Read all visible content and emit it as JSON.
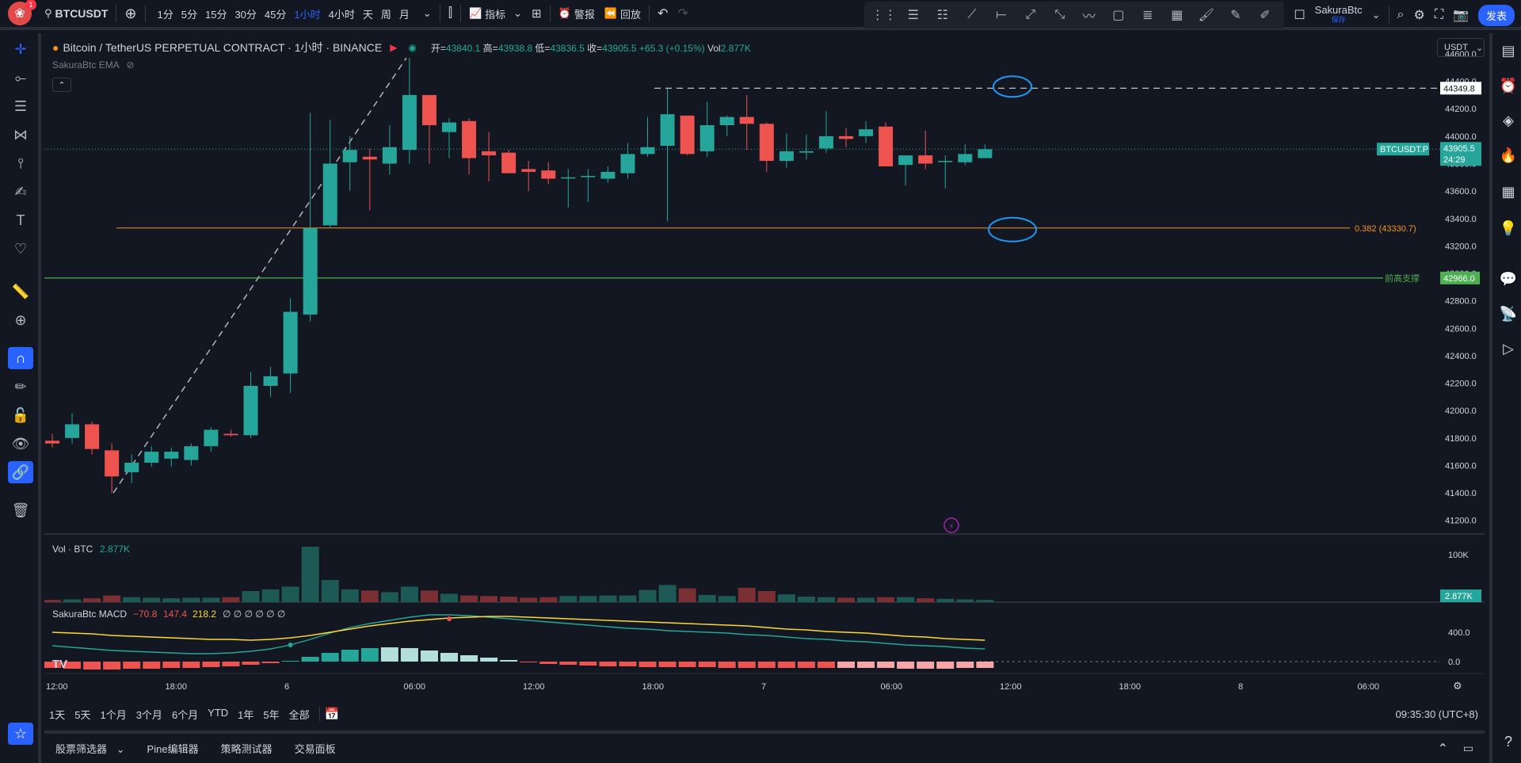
{
  "topbar": {
    "badge": "1",
    "symbol": "BTCUSDT",
    "timeframes": [
      "1分",
      "5分",
      "15分",
      "30分",
      "45分",
      "1小时",
      "4小时",
      "天",
      "周",
      "月"
    ],
    "active_timeframe": "1小时",
    "indicators_label": "指标",
    "alert_label": "警报",
    "replay_label": "回放",
    "user_name": "SakuraBtc",
    "user_sub": "保存",
    "publish_label": "发表"
  },
  "legend": {
    "title": "Bitcoin / TetherUS PERPETUAL CONTRACT · 1小时 · BINANCE",
    "open_k": "开=",
    "open_v": "43840.1",
    "high_k": "高=",
    "high_v": "43938.8",
    "low_k": "低=",
    "low_v": "43836.5",
    "close_k": "收=",
    "close_v": "43905.5",
    "change": "+65.3 (+0.15%)",
    "vol_k": "Vol",
    "vol_v": "2.877K",
    "ema": "SakuraBtc EMA",
    "unit": "USDT"
  },
  "price_axis": {
    "ticks": [
      "44600.0",
      "44400.0",
      "44200.0",
      "44000.0",
      "43800.0",
      "43600.0",
      "43400.0",
      "43200.0",
      "43000.0",
      "42800.0",
      "42600.0",
      "42400.0",
      "42200.0",
      "42000.0",
      "41800.0",
      "41600.0",
      "41400.0",
      "41200.0"
    ],
    "dashed_label": "44349.8",
    "current_name": "BTCUSDT.P",
    "current_price": "43905.5",
    "countdown": "24:29",
    "fib_label": "0.382 (43330.7)",
    "support_name": "前高支撑",
    "support_price": "42966.0"
  },
  "volume_pane": {
    "label": "Vol · BTC",
    "value": "2.877K",
    "axis": "100K",
    "badge": "2.877K"
  },
  "macd_pane": {
    "label": "SakuraBtc MACD",
    "v1": "−70.8",
    "v2": "147.4",
    "v3": "218.2",
    "rest": "∅ ∅ ∅ ∅ ∅ ∅",
    "axis_top": "400.0",
    "axis_zero": "0.0"
  },
  "time_axis": [
    "12:00",
    "18:00",
    "6",
    "06:00",
    "12:00",
    "18:00",
    "7",
    "06:00",
    "12:00",
    "18:00",
    "8",
    "06:00"
  ],
  "rangebar": {
    "ranges": [
      "1天",
      "5天",
      "1个月",
      "3个月",
      "6个月",
      "YTD",
      "1年",
      "5年",
      "全部"
    ],
    "clock": "09:35:30 (UTC+8)"
  },
  "bottombar": {
    "tabs": [
      "股票筛选器",
      "Pine编辑器",
      "策略测试器",
      "交易面板"
    ]
  },
  "chart_data": {
    "type": "candlestick",
    "title": "Bitcoin / TetherUS PERPETUAL CONTRACT · 1小时 · BINANCE",
    "ylim": [
      41100,
      44750
    ],
    "x_index_start": 0,
    "candles": [
      {
        "o": 41780,
        "h": 41830,
        "l": 41730,
        "c": 41760
      },
      {
        "o": 41800,
        "h": 41980,
        "l": 41760,
        "c": 41900
      },
      {
        "o": 41900,
        "h": 41920,
        "l": 41680,
        "c": 41720
      },
      {
        "o": 41710,
        "h": 41760,
        "l": 41400,
        "c": 41520
      },
      {
        "o": 41550,
        "h": 41680,
        "l": 41470,
        "c": 41620
      },
      {
        "o": 41620,
        "h": 41740,
        "l": 41590,
        "c": 41700
      },
      {
        "o": 41650,
        "h": 41730,
        "l": 41590,
        "c": 41700
      },
      {
        "o": 41640,
        "h": 41760,
        "l": 41600,
        "c": 41740
      },
      {
        "o": 41740,
        "h": 41880,
        "l": 41700,
        "c": 41860
      },
      {
        "o": 41830,
        "h": 41860,
        "l": 41810,
        "c": 41820
      },
      {
        "o": 41820,
        "h": 42280,
        "l": 41800,
        "c": 42180
      },
      {
        "o": 42180,
        "h": 42320,
        "l": 42100,
        "c": 42250
      },
      {
        "o": 42270,
        "h": 42820,
        "l": 42130,
        "c": 42720
      },
      {
        "o": 42700,
        "h": 44170,
        "l": 42650,
        "c": 43330
      },
      {
        "o": 43350,
        "h": 44120,
        "l": 43330,
        "c": 43800
      },
      {
        "o": 43810,
        "h": 44000,
        "l": 43600,
        "c": 43900
      },
      {
        "o": 43850,
        "h": 43910,
        "l": 43460,
        "c": 43830
      },
      {
        "o": 43800,
        "h": 44080,
        "l": 43720,
        "c": 43920
      },
      {
        "o": 43900,
        "h": 44570,
        "l": 43800,
        "c": 44300
      },
      {
        "o": 44300,
        "h": 44300,
        "l": 43800,
        "c": 44080
      },
      {
        "o": 44030,
        "h": 44130,
        "l": 43840,
        "c": 44100
      },
      {
        "o": 44110,
        "h": 44130,
        "l": 43720,
        "c": 43840
      },
      {
        "o": 43890,
        "h": 44030,
        "l": 43670,
        "c": 43860
      },
      {
        "o": 43880,
        "h": 43900,
        "l": 43730,
        "c": 43730
      },
      {
        "o": 43760,
        "h": 43820,
        "l": 43600,
        "c": 43740
      },
      {
        "o": 43750,
        "h": 43810,
        "l": 43650,
        "c": 43690
      },
      {
        "o": 43700,
        "h": 43760,
        "l": 43480,
        "c": 43700
      },
      {
        "o": 43710,
        "h": 43760,
        "l": 43520,
        "c": 43710
      },
      {
        "o": 43690,
        "h": 43780,
        "l": 43660,
        "c": 43740
      },
      {
        "o": 43730,
        "h": 43950,
        "l": 43690,
        "c": 43870
      },
      {
        "o": 43870,
        "h": 44140,
        "l": 43850,
        "c": 43920
      },
      {
        "o": 43930,
        "h": 44350,
        "l": 43380,
        "c": 44160
      },
      {
        "o": 44150,
        "h": 44150,
        "l": 43860,
        "c": 43870
      },
      {
        "o": 43890,
        "h": 44250,
        "l": 43850,
        "c": 44080
      },
      {
        "o": 44080,
        "h": 44150,
        "l": 44000,
        "c": 44140
      },
      {
        "o": 44140,
        "h": 44300,
        "l": 43900,
        "c": 44090
      },
      {
        "o": 44090,
        "h": 44100,
        "l": 43740,
        "c": 43820
      },
      {
        "o": 43820,
        "h": 44020,
        "l": 43770,
        "c": 43890
      },
      {
        "o": 43880,
        "h": 44010,
        "l": 43830,
        "c": 43890
      },
      {
        "o": 43910,
        "h": 44180,
        "l": 43880,
        "c": 44000
      },
      {
        "o": 44000,
        "h": 44060,
        "l": 43920,
        "c": 43980
      },
      {
        "o": 44000,
        "h": 44110,
        "l": 43950,
        "c": 44050
      },
      {
        "o": 44070,
        "h": 44100,
        "l": 43800,
        "c": 43780
      },
      {
        "o": 43790,
        "h": 43860,
        "l": 43640,
        "c": 43860
      },
      {
        "o": 43860,
        "h": 44040,
        "l": 43760,
        "c": 43800
      },
      {
        "o": 43820,
        "h": 43860,
        "l": 43620,
        "c": 43820
      },
      {
        "o": 43810,
        "h": 43940,
        "l": 43790,
        "c": 43870
      },
      {
        "o": 43840,
        "h": 43940,
        "l": 43840,
        "c": 43905
      }
    ],
    "volumes": [
      0.04,
      0.05,
      0.07,
      0.12,
      0.09,
      0.08,
      0.07,
      0.08,
      0.08,
      0.09,
      0.2,
      0.23,
      0.28,
      1.0,
      0.4,
      0.23,
      0.21,
      0.18,
      0.28,
      0.21,
      0.15,
      0.12,
      0.11,
      0.1,
      0.08,
      0.09,
      0.11,
      0.11,
      0.12,
      0.12,
      0.22,
      0.31,
      0.25,
      0.13,
      0.11,
      0.26,
      0.2,
      0.14,
      0.1,
      0.09,
      0.08,
      0.08,
      0.09,
      0.09,
      0.07,
      0.06,
      0.05,
      0.04
    ],
    "levels": {
      "dashed": 44349.8,
      "current": 43905.5,
      "fib_0382": 43330.7,
      "support": 42966.0
    }
  },
  "colors": {
    "up": "#26a69a",
    "down": "#ef5350",
    "bg": "#131722",
    "accent": "#2962ff",
    "fib": "#f7931a",
    "support": "#4caf50",
    "circle": "#2196f3"
  }
}
